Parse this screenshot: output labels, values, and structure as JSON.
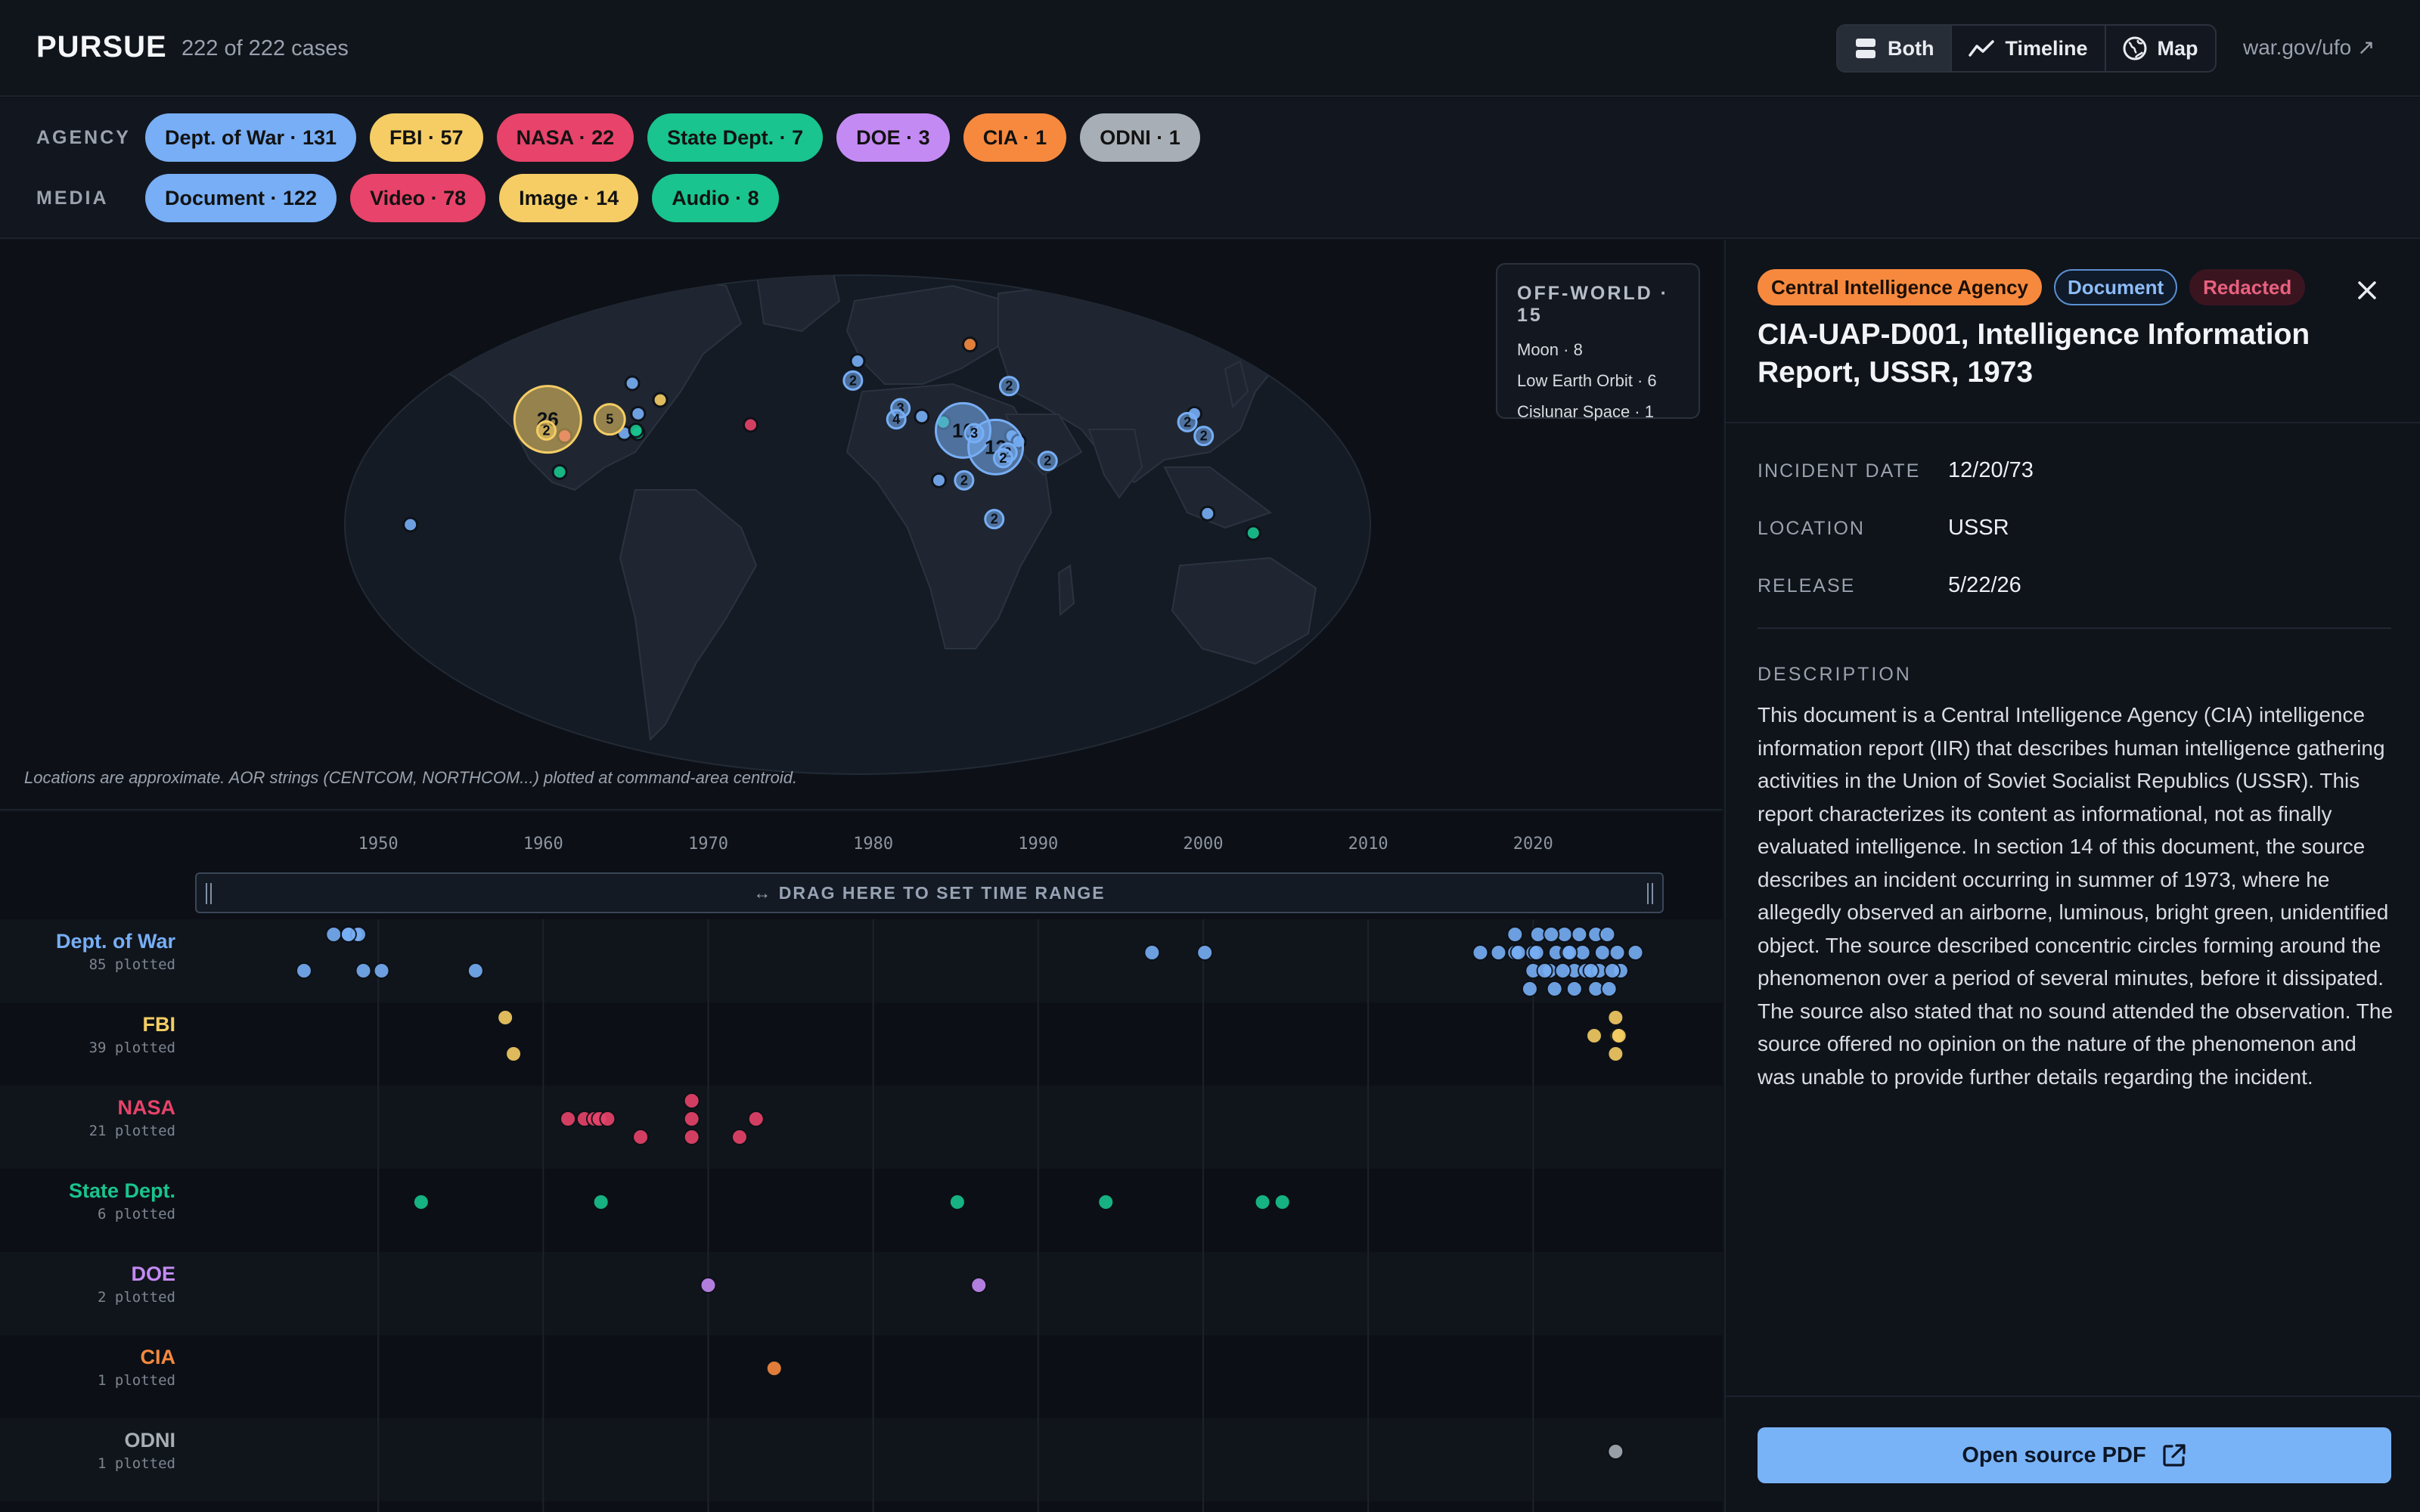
{
  "app": {
    "title": "PURSUE",
    "case_count": "222 of 222 cases"
  },
  "view_toggle": [
    {
      "label": "Both",
      "icon": "split-view-icon",
      "active": true
    },
    {
      "label": "Timeline",
      "icon": "trend-line-icon",
      "active": false
    },
    {
      "label": "Map",
      "icon": "globe-icon",
      "active": false
    }
  ],
  "external_link": {
    "label": "war.gov/ufo ↗"
  },
  "filters": {
    "agency": {
      "label": "AGENCY",
      "chips": [
        {
          "label": "Dept. of War · 131",
          "color": "#77aef5"
        },
        {
          "label": "FBI · 57",
          "color": "#f5cd64"
        },
        {
          "label": "NASA · 22",
          "color": "#e8436a"
        },
        {
          "label": "State Dept. · 7",
          "color": "#19c48e"
        },
        {
          "label": "DOE · 3",
          "color": "#c48af3"
        },
        {
          "label": "CIA · 1",
          "color": "#f7893e"
        },
        {
          "label": "ODNI · 1",
          "color": "#a8aeb6"
        }
      ]
    },
    "media": {
      "label": "MEDIA",
      "chips": [
        {
          "label": "Document · 122",
          "color": "#77aef5"
        },
        {
          "label": "Video · 78",
          "color": "#e8436a"
        },
        {
          "label": "Image · 14",
          "color": "#f5cd64"
        },
        {
          "label": "Audio · 8",
          "color": "#19c48e"
        }
      ]
    }
  },
  "map": {
    "offworld": {
      "title": "OFF-WORLD · 15",
      "items": [
        "Moon · 8",
        "Low Earth Orbit · 6",
        "Cislunar Space · 1"
      ]
    },
    "note": "Locations are approximate. AOR strings (CENTCOM, NORTHCOM...) plotted at command-area centroid.",
    "clusters": [
      {
        "lon": -120,
        "lat": 38,
        "count": "26",
        "color": "#f5cd64",
        "size": "xl"
      },
      {
        "lon": -96,
        "lat": 38,
        "count": "5",
        "color": "#f5cd64",
        "size": "m"
      },
      {
        "lon": -118,
        "lat": 34,
        "count": "2",
        "color": "#f5cd64",
        "size": "s"
      },
      {
        "lon": 40,
        "lat": 34,
        "count": "10",
        "color": "#77aef5",
        "size": "l"
      },
      {
        "lon": 51,
        "lat": 28,
        "count": "12",
        "color": "#77aef5",
        "size": "l"
      },
      {
        "lon": 44,
        "lat": 33,
        "count": "3",
        "color": "#77aef5",
        "size": "s"
      },
      {
        "lon": 55,
        "lat": 26,
        "count": "2",
        "color": "#77aef5",
        "size": "s"
      },
      {
        "lon": 53,
        "lat": 24,
        "count": "2",
        "color": "#77aef5",
        "size": "s"
      },
      {
        "lon": 17,
        "lat": 42,
        "count": "3",
        "color": "#77aef5",
        "size": "s"
      },
      {
        "lon": 15,
        "lat": 38,
        "count": "4",
        "color": "#77aef5",
        "size": "s"
      },
      {
        "lon": -2,
        "lat": 52,
        "count": "2",
        "color": "#77aef5",
        "size": "s"
      },
      {
        "lon": 64,
        "lat": 50,
        "count": "2",
        "color": "#77aef5",
        "size": "s"
      },
      {
        "lon": 127,
        "lat": 37,
        "count": "2",
        "color": "#77aef5",
        "size": "s"
      },
      {
        "lon": 130,
        "lat": 32,
        "count": "2",
        "color": "#77aef5",
        "size": "s"
      },
      {
        "lon": 48,
        "lat": 2,
        "count": "2",
        "color": "#77aef5",
        "size": "s"
      },
      {
        "lon": 38,
        "lat": 16,
        "count": "2",
        "color": "#77aef5",
        "size": "s"
      },
      {
        "lon": 69,
        "lat": 23,
        "count": "2",
        "color": "#77aef5",
        "size": "s"
      }
    ],
    "points": [
      {
        "lon": -80,
        "lat": 45,
        "color": "#f5cd64"
      },
      {
        "lon": -86,
        "lat": 40,
        "color": "#77aef5"
      },
      {
        "lon": -96,
        "lat": 51,
        "color": "#77aef5"
      },
      {
        "lon": -88,
        "lat": 33,
        "color": "#77aef5"
      },
      {
        "lon": -83,
        "lat": 33,
        "color": "#19c48e"
      },
      {
        "lon": -84,
        "lat": 34,
        "color": "#19c48e"
      },
      {
        "lon": -110,
        "lat": 32,
        "color": "#e8436a"
      },
      {
        "lon": -107,
        "lat": 19,
        "color": "#19c48e"
      },
      {
        "lon": -41,
        "lat": 36,
        "color": "#e8436a"
      },
      {
        "lon": -157,
        "lat": 0,
        "color": "#77aef5"
      },
      {
        "lon": 0,
        "lat": 59,
        "color": "#77aef5"
      },
      {
        "lon": 25,
        "lat": 39,
        "color": "#77aef5"
      },
      {
        "lon": 33,
        "lat": 37,
        "color": "#19c48e"
      },
      {
        "lon": 57,
        "lat": 65,
        "color": "#f7893e"
      },
      {
        "lon": 58,
        "lat": 32,
        "color": "#77aef5"
      },
      {
        "lon": 60,
        "lat": 30,
        "color": "#77aef5"
      },
      {
        "lon": 29,
        "lat": 16,
        "color": "#77aef5"
      },
      {
        "lon": 132,
        "lat": 40,
        "color": "#77aef5"
      },
      {
        "lon": 123,
        "lat": 4,
        "color": "#77aef5"
      },
      {
        "lon": 139,
        "lat": -3,
        "color": "#19c48e"
      }
    ]
  },
  "timeline": {
    "range_label": "↔ DRAG HERE TO SET TIME RANGE",
    "years": [
      {
        "label": "1950",
        "value": 1950
      },
      {
        "label": "1960",
        "value": 1960
      },
      {
        "label": "1970",
        "value": 1970
      },
      {
        "label": "1980",
        "value": 1980
      },
      {
        "label": "1990",
        "value": 1990
      },
      {
        "label": "2000",
        "value": 2000
      },
      {
        "label": "2010",
        "value": 2010
      },
      {
        "label": "2020",
        "value": 2020
      }
    ],
    "lanes": [
      {
        "name": "Dept. of War",
        "sub": "85 plotted",
        "color": "#77aef5",
        "events": [
          [
            1947.3,
            0
          ],
          [
            1948.2,
            0
          ],
          [
            1948.6,
            0
          ],
          [
            1948.2,
            0
          ],
          [
            1948.8,
            0
          ],
          [
            1948.2,
            0
          ],
          [
            1945.5,
            2
          ],
          [
            1949.1,
            2
          ],
          [
            1950.2,
            2
          ],
          [
            1955.9,
            2
          ],
          [
            1996.9,
            1
          ],
          [
            2000.1,
            1
          ],
          [
            2016.8,
            1
          ],
          [
            2017.9,
            1
          ],
          [
            2018.9,
            1
          ],
          [
            2019.1,
            1
          ],
          [
            2020.0,
            1
          ],
          [
            2021.4,
            1
          ],
          [
            2022.1,
            1
          ],
          [
            2023.0,
            1
          ],
          [
            2024.2,
            1
          ],
          [
            2025.1,
            1
          ],
          [
            2026.2,
            1
          ],
          [
            2018.9,
            0
          ],
          [
            2020.3,
            0
          ],
          [
            2021.9,
            0
          ],
          [
            2022.8,
            0
          ],
          [
            2023.8,
            0
          ],
          [
            2024.5,
            0
          ],
          [
            2020.0,
            2
          ],
          [
            2021.0,
            2
          ],
          [
            2022.5,
            2
          ],
          [
            2023.2,
            2
          ],
          [
            2024.0,
            2
          ],
          [
            2025.3,
            2
          ],
          [
            2019.8,
            3
          ],
          [
            2021.3,
            3
          ],
          [
            2022.5,
            3
          ],
          [
            2023.8,
            3
          ],
          [
            2024.6,
            3
          ],
          [
            2020.7,
            2
          ],
          [
            2021.8,
            2
          ],
          [
            2023.5,
            2
          ],
          [
            2024.8,
            2
          ],
          [
            2020.2,
            1
          ],
          [
            2021.1,
            0
          ],
          [
            2022.2,
            1
          ]
        ]
      },
      {
        "name": "FBI",
        "sub": "39 plotted",
        "color": "#f5cd64",
        "events": [
          [
            1957.7,
            0
          ],
          [
            1958.2,
            2
          ],
          [
            2023.7,
            1
          ],
          [
            2025.0,
            0
          ],
          [
            2025.1,
            1
          ],
          [
            2025.0,
            2
          ],
          [
            2025.2,
            1
          ]
        ]
      },
      {
        "name": "NASA",
        "sub": "21 plotted",
        "color": "#e8436a",
        "events": [
          [
            1969.0,
            0
          ],
          [
            1961.5,
            1
          ],
          [
            1962.5,
            1
          ],
          [
            1963.1,
            1
          ],
          [
            1963.4,
            1
          ],
          [
            1963.9,
            1
          ],
          [
            1969.0,
            1
          ],
          [
            1972.9,
            1
          ],
          [
            1965.9,
            2
          ],
          [
            1969.0,
            2
          ],
          [
            1971.9,
            2
          ]
        ]
      },
      {
        "name": "State Dept.",
        "sub": "6 plotted",
        "color": "#19c48e",
        "events": [
          [
            1952.6,
            1
          ],
          [
            1963.5,
            1
          ],
          [
            1985.1,
            1
          ],
          [
            1994.1,
            1
          ],
          [
            2003.6,
            1
          ],
          [
            2004.8,
            1
          ]
        ]
      },
      {
        "name": "DOE",
        "sub": "2 plotted",
        "color": "#c48af3",
        "events": [
          [
            1970.0,
            1
          ],
          [
            1986.4,
            1
          ]
        ]
      },
      {
        "name": "CIA",
        "sub": "1 plotted",
        "color": "#f7893e",
        "events": [
          [
            1974.0,
            1
          ]
        ]
      },
      {
        "name": "ODNI",
        "sub": "1 plotted",
        "color": "#a8aeb6",
        "events": [
          [
            2025.0,
            1
          ]
        ]
      }
    ]
  },
  "detail": {
    "badges": [
      {
        "label": "Central Intelligence Agency",
        "bg": "#f7893e",
        "fg": "#1a0f05",
        "border": "#f7893e"
      },
      {
        "label": "Document",
        "bg": "#0f1a2a",
        "fg": "#8cbcf8",
        "border": "#5a8fd0"
      },
      {
        "label": "Redacted",
        "bg": "#3a1520",
        "fg": "#e8617f",
        "border": "#3a1520"
      }
    ],
    "title": "CIA-UAP-D001, Intelligence Information Report, USSR, 1973",
    "fields": [
      {
        "key": "INCIDENT DATE",
        "value": "12/20/73"
      },
      {
        "key": "LOCATION",
        "value": "USSR"
      },
      {
        "key": "RELEASE",
        "value": "5/22/26"
      }
    ],
    "description_label": "DESCRIPTION",
    "description": "This document is a Central Intelligence Agency (CIA) intelligence information report (IIR) that describes human intelligence gathering activities in the Union of Soviet Socialist Republics (USSR). This report characterizes its content as informational, not as finally evaluated intelligence. In section 14 of this document, the source describes an incident occurring in summer of 1973, where he allegedly observed an airborne, luminous, bright green, unidentified object. The source described concentric circles forming around the phenomenon over a period of several minutes, before it dissipated. The source also stated that no sound attended the observation. The source offered no opinion on the nature of the phenomenon and was unable to provide further details regarding the incident.",
    "pdf_button": "Open source PDF"
  }
}
